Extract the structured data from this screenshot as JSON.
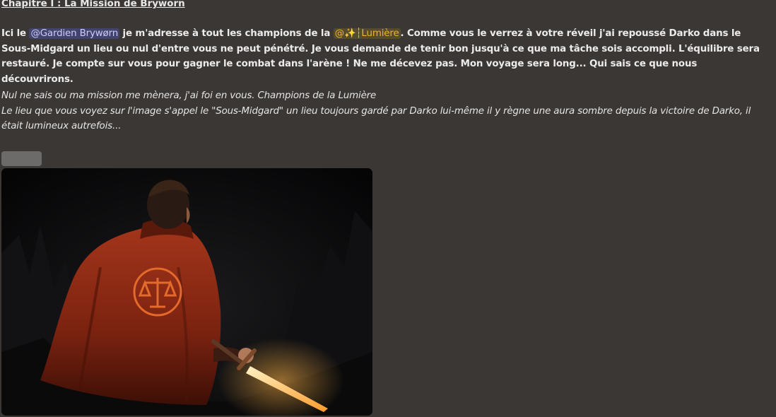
{
  "message": {
    "title": "Chapitre I : La Mission de Bryworn",
    "paragraph1": {
      "prefix": "Ici le ",
      "mention_user": "@Gardien Brywørn",
      "mid": " je m'adresse à tout les champions de la ",
      "mention_role": "@✨┆Lumière",
      "suffix": ". Comme vous le verrez à votre réveil j'ai repoussé Darko dans le Sous-Midgard un lieu ou nul d'entre vous ne peut pénétré. Je vous demande de tenir bon jusqu'à ce que ma tâche sois accompli. L'équilibre sera restauré. Je compte sur vous pour gagner le combat dans l'arène ! Ne me décevez pas. Mon voyage sera long... Qui sais ce que nous découvrirons."
    },
    "italic_line1": "Nul ne sais ou ma mission me mènera, j'ai foi en vous. Champions de la Lumière",
    "italic_line2": "Le lieu que vous voyez sur l'image s'appel le \"Sous-Midgard\" un lieu toujours gardé par Darko lui-même il y règne une aura sombre depuis la victoire de Darko, il était lumineux autrefois..."
  },
  "colors": {
    "background": "#3a3734",
    "mention_user_bg": "#4a4f86",
    "mention_role_text": "#f0b232",
    "cape": "#8a2a12",
    "sword_glow": "#ffb347"
  },
  "image": {
    "icon": "scales-of-justice-icon"
  }
}
